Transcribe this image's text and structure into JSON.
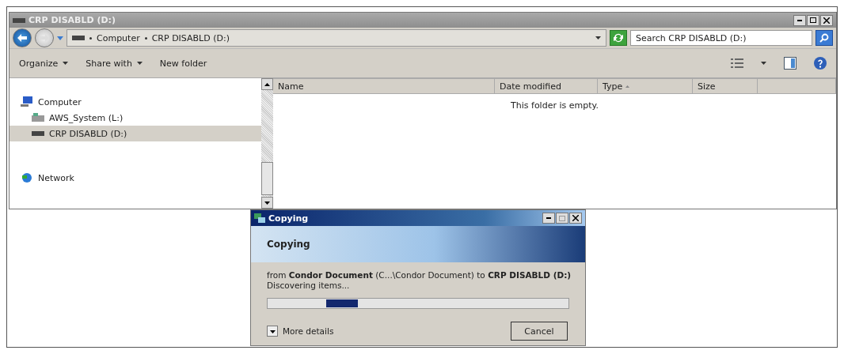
{
  "window": {
    "title": "CRP DISABLD (D:)"
  },
  "address": {
    "crumbs": [
      "Computer",
      "CRP DISABLD (D:)"
    ]
  },
  "search": {
    "placeholder": "Search CRP DISABLD (D:)"
  },
  "toolbar": {
    "items": [
      {
        "label": "Organize",
        "dropdown": true
      },
      {
        "label": "Share with",
        "dropdown": true
      },
      {
        "label": "New folder",
        "dropdown": false
      }
    ]
  },
  "nav": {
    "items": [
      {
        "label": "Computer",
        "kind": "computer",
        "selected": false,
        "children": [
          {
            "label": "AWS_System (L:)",
            "kind": "disk",
            "selected": false
          },
          {
            "label": "CRP DISABLD (D:)",
            "kind": "drive",
            "selected": true
          }
        ]
      },
      {
        "label": "Network",
        "kind": "network",
        "selected": false
      }
    ]
  },
  "table": {
    "columns": [
      {
        "label": "Name",
        "sorted": false
      },
      {
        "label": "Date modified",
        "sorted": false
      },
      {
        "label": "Type",
        "sorted": true
      },
      {
        "label": "Size",
        "sorted": false
      }
    ],
    "empty_message": "This folder is empty."
  },
  "dialog": {
    "title": "Copying",
    "heading": "Copying",
    "message": "from **Condor Document** (C...\\Condor Document) to **CRP DISABLD (D:)**",
    "status": "Discovering items...",
    "progress": {
      "indeterminate": true
    },
    "details_label": "More details",
    "cancel": "Cancel"
  }
}
